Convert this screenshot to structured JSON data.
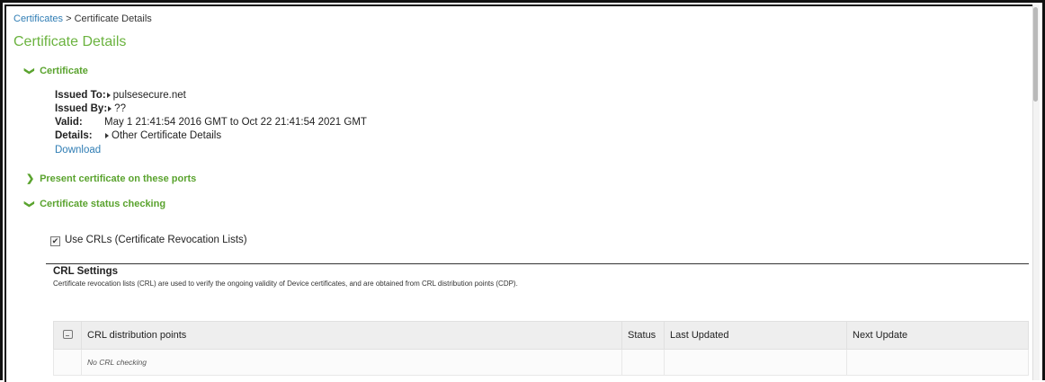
{
  "breadcrumb": {
    "parent": "Certificates",
    "separator": ">",
    "current": "Certificate Details"
  },
  "page_title": "Certificate Details",
  "sections": {
    "certificate": {
      "label": "Certificate",
      "expanded": true,
      "icon": "chevron-down-icon"
    },
    "ports": {
      "label": "Present certificate on these ports",
      "expanded": false,
      "icon": "chevron-right-icon"
    },
    "status": {
      "label": "Certificate status checking",
      "expanded": true,
      "icon": "chevron-down-icon"
    }
  },
  "certificate": {
    "issued_to_label": "Issued To:",
    "issued_to_value": "pulsesecure.net",
    "issued_by_label": "Issued By:",
    "issued_by_value": "??",
    "valid_label": "Valid:",
    "valid_value": "May 1 21:41:54 2016 GMT to Oct 22 21:41:54 2021 GMT",
    "details_label": "Details:",
    "details_value": "Other Certificate Details",
    "download_label": "Download"
  },
  "crl": {
    "use_crl_label": "Use CRLs (Certificate Revocation Lists)",
    "use_crl_checked": true,
    "settings_title": "CRL Settings",
    "settings_desc": "Certificate revocation lists (CRL) are used to verify the ongoing validity of Device certificates, and are obtained from CRL distribution points (CDP).",
    "table": {
      "columns": [
        "CRL distribution points",
        "Status",
        "Last Updated",
        "Next Update"
      ],
      "empty_message": "No CRL checking"
    }
  },
  "colors": {
    "accent_green": "#6bb33f",
    "link_blue": "#2f7db4"
  }
}
